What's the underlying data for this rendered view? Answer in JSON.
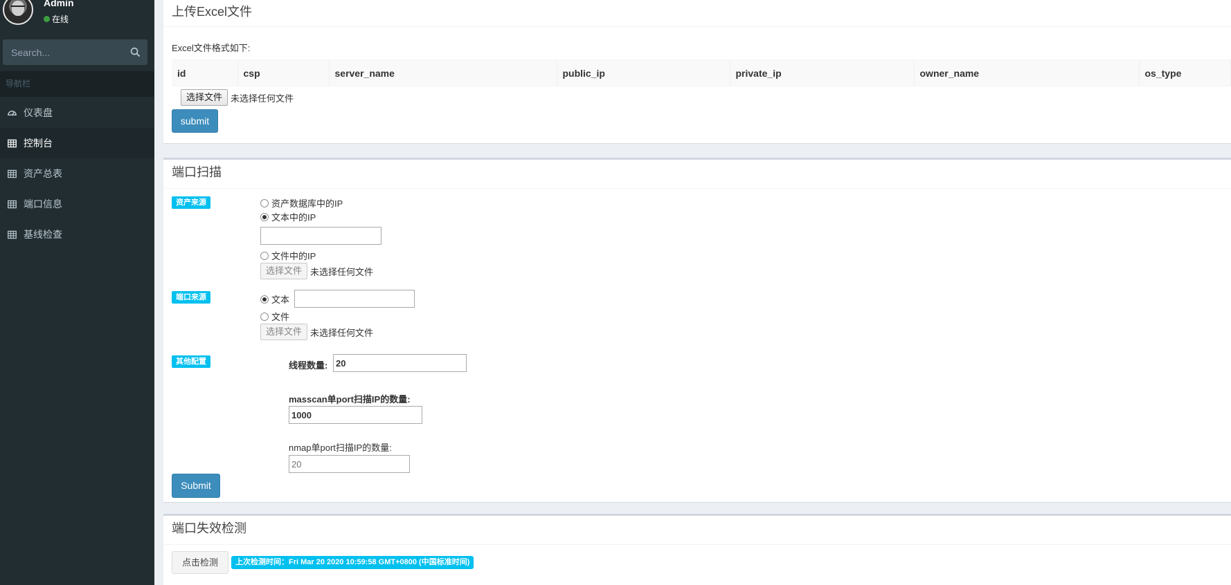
{
  "user": {
    "name": "Admin",
    "status": "在线"
  },
  "sidebar": {
    "search_placeholder": "Search...",
    "nav_header": "导航栏",
    "items": [
      {
        "label": "仪表盘",
        "icon": "dashboard-icon"
      },
      {
        "label": "控制台",
        "icon": "table-icon"
      },
      {
        "label": "资产总表",
        "icon": "table-icon"
      },
      {
        "label": "端口信息",
        "icon": "table-icon"
      },
      {
        "label": "基线检查",
        "icon": "table-icon"
      }
    ]
  },
  "upload": {
    "title": "上传Excel文件",
    "format_label": "Excel文件格式如下:",
    "columns": [
      "id",
      "csp",
      "server_name",
      "public_ip",
      "private_ip",
      "owner_name",
      "os_type"
    ],
    "file_button": "选择文件",
    "file_status": "未选择任何文件",
    "submit": "submit"
  },
  "scan": {
    "title": "端口扫描",
    "asset_source_label": "资产来源",
    "asset_options": [
      "资产数据库中的IP",
      "文本中的IP",
      "文件中的IP"
    ],
    "asset_selected": "文本中的IP",
    "asset_text_value": "",
    "asset_file_button": "选择文件",
    "asset_file_status": "未选择任何文件",
    "port_source_label": "端口来源",
    "port_options": [
      "文本",
      "文件"
    ],
    "port_selected": "文本",
    "port_text_value": "",
    "port_file_button": "选择文件",
    "port_file_status": "未选择任何文件",
    "other_config_label": "其他配置",
    "threads_label": "线程数量:",
    "threads_value": "20",
    "masscan_label": "masscan单port扫描IP的数量:",
    "masscan_value": "1000",
    "nmap_label": "nmap单port扫描IP的数量:",
    "nmap_placeholder": "20",
    "submit": "Submit"
  },
  "check": {
    "title": "端口失效检测",
    "button": "点击检测",
    "last_check": "上次检测时间：Fri Mar 20 2020 10:59:58 GMT+0800 (中国标准时间)"
  },
  "colors": {
    "sidebar_bg": "#222d32",
    "primary": "#3c8dbc",
    "info": "#00c0ef",
    "online": "#3c9f40"
  }
}
